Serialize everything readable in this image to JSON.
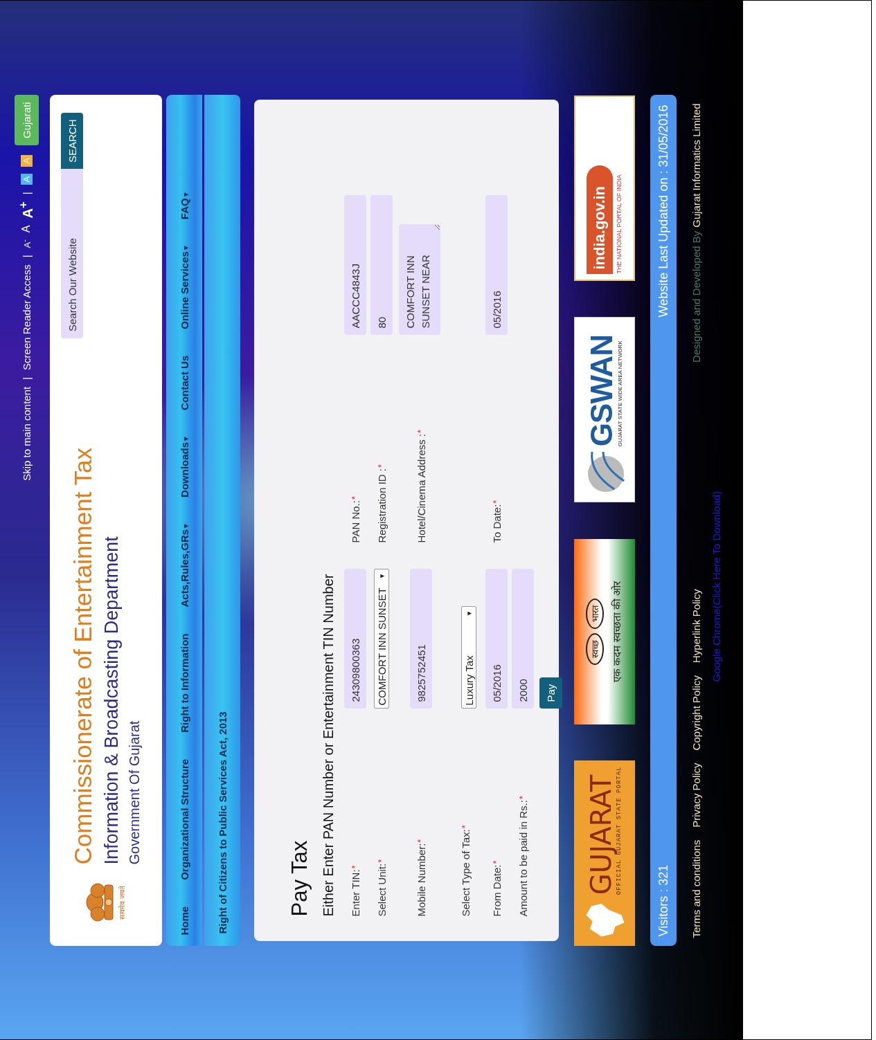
{
  "top_bar": {
    "links": [
      {
        "kind": "link",
        "text": "Skip to main content"
      },
      {
        "kind": "sep",
        "text": "|"
      },
      {
        "kind": "link",
        "text": "Screen Reader Access"
      },
      {
        "kind": "sep",
        "text": "|"
      },
      {
        "kind": "decrease",
        "text": "A$^{-}$"
      },
      {
        "kind": "reset",
        "text": "A"
      },
      {
        "kind": "increase",
        "text": "A$^{+}$"
      },
      {
        "kind": "sep",
        "text": "|"
      },
      {
        "kind": "theme",
        "text": "A",
        "color": "#4fb6ef"
      },
      {
        "kind": "theme",
        "text": "A",
        "color": "#f5b041"
      }
    ],
    "language_button": "Gujarati"
  },
  "header": {
    "emblem_motto": "सत्यमेव जयते",
    "title": "Commissionerate of Entertainment Tax",
    "department": "Information & Broadcasting Department",
    "government": "Government Of Gujarat",
    "search": {
      "placeholder": "Search Our Website",
      "button": "SEARCH"
    }
  },
  "nav": [
    {
      "label": "Home"
    },
    {
      "label": "Organizational Structure"
    },
    {
      "label": "Right to Information"
    },
    {
      "label": "Acts,Rules,GRs",
      "menu_icon": "▾"
    },
    {
      "label": "Downloads",
      "menu_icon": "▾"
    },
    {
      "label": "Contact Us"
    },
    {
      "label": "Online Services",
      "menu_icon": "▾"
    },
    {
      "label": "FAQ",
      "menu_icon": "▾"
    }
  ],
  "notice_bar": "Right of Citizens to Public Services Act, 2013",
  "form": {
    "title": "Pay Tax",
    "subtitle": "Either Enter PAN Number or Entertainment TIN Number",
    "rows": [
      {
        "left": {
          "label": "Enter TIN:",
          "required_mark": "*",
          "kind": "input",
          "value": "24309800363"
        },
        "right": {
          "label": "PAN No.:",
          "required_mark": "*",
          "kind": "input",
          "value": "AACCC4843J"
        }
      },
      {
        "left": {
          "label": "Select Unit:",
          "required_mark": "*",
          "kind": "select",
          "value": "COMFORT INN SUNSET",
          "arrow": "▼"
        },
        "right": {
          "label": "Registration ID :",
          "required_mark": "*",
          "kind": "input",
          "value": "80"
        }
      },
      {
        "left": {
          "label": "Mobile Number:",
          "required_mark": "*",
          "kind": "input",
          "value": "9825752451"
        },
        "right": {
          "label": "Hotel/Cinema Address :",
          "required_mark": "*",
          "kind": "textarea",
          "value": "COMFORT INN SUNSET NEAR"
        }
      },
      {
        "left": {
          "label": "Select Type of Tax:",
          "required_mark": "*",
          "kind": "select",
          "value": "Luxury Tax",
          "arrow": "▼"
        }
      },
      {
        "left": {
          "label": "From Date:",
          "required_mark": "*",
          "kind": "input",
          "value": "05/2016"
        },
        "right": {
          "label": "To Date:",
          "required_mark": "*",
          "kind": "input",
          "value": "05/2016"
        }
      },
      {
        "left": {
          "label": "Amount to be paid in Rs.:",
          "required_mark": "*",
          "kind": "input",
          "value": "2000"
        }
      }
    ],
    "submit": "Pay"
  },
  "banners": [
    {
      "kind": "gujarat",
      "title": "GUJARAT",
      "subtitle": "OFFICIAL GUJARAT STATE PORTAL"
    },
    {
      "kind": "swachh",
      "title": "स्वच्छ",
      "title2": "भारत",
      "subtitle": "एक कदम स्वच्छता की ओर"
    },
    {
      "kind": "gswan",
      "title": "GSWAN",
      "subtitle": "GUJARAT STATE WIDE AREA NETWORK"
    },
    {
      "kind": "india",
      "title": "india.gov.in",
      "subtitle": "THE NATIONAL PORTAL OF INDIA"
    }
  ],
  "info_bar": {
    "visitors": "Visitors : 321",
    "last_updated": "Website Last Updated on : 31/05/2016"
  },
  "footer": {
    "links": [
      "Terms and conditions",
      "Privacy Policy",
      "Copyright Policy",
      "Hyperlink Policy"
    ],
    "chrome_link": "Google Chrome(Click Here To Download)",
    "credit_prefix": "Designed and Developed By",
    "credit_name": "Gujarat Informatics Limited"
  }
}
